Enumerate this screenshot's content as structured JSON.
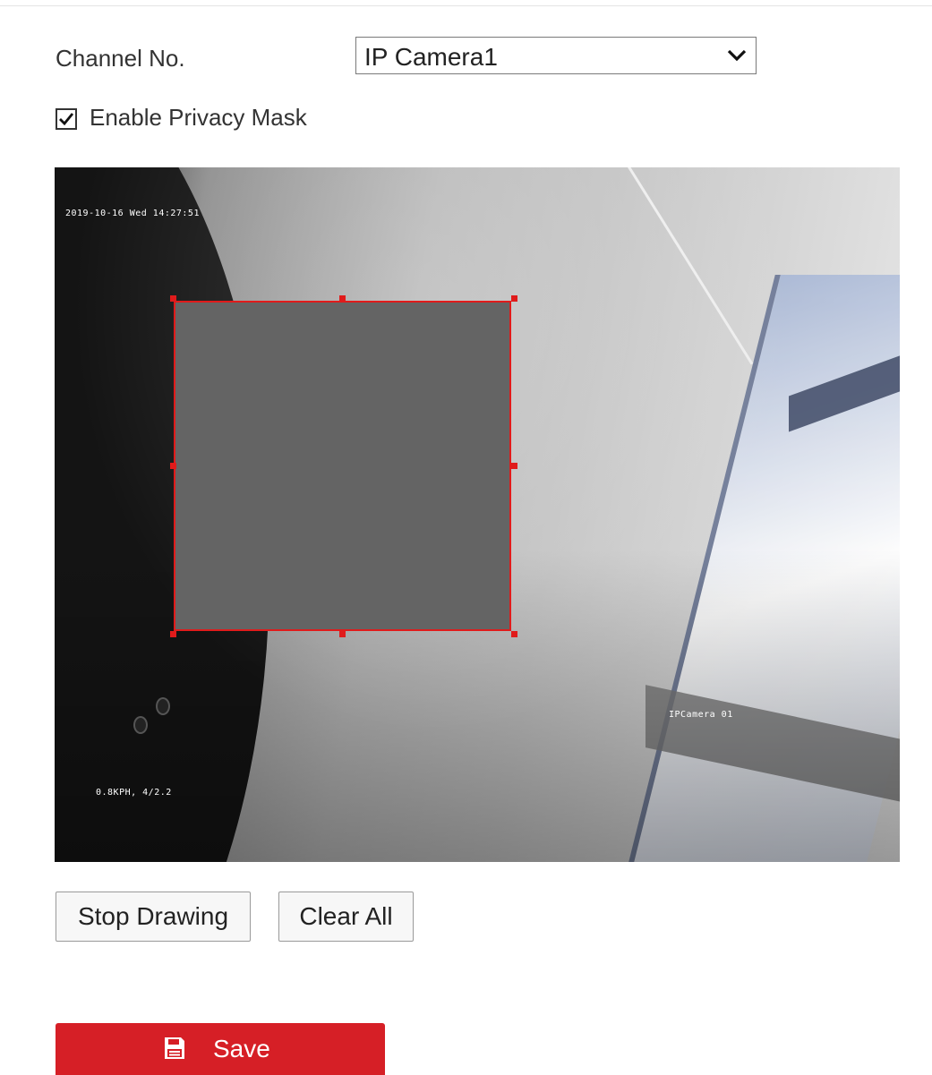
{
  "form": {
    "channel_label": "Channel No.",
    "channel_value": "IP Camera1",
    "privacy_mask_label": "Enable Privacy Mask",
    "privacy_mask_checked": true
  },
  "video": {
    "osd_timestamp": "2019-10-16 Wed 14:27:51",
    "osd_camera_name": "IPCamera 01",
    "osd_lens": "0.8KPH, 4/2.2"
  },
  "buttons": {
    "stop_drawing": "Stop Drawing",
    "clear_all": "Clear All",
    "save": "Save"
  },
  "colors": {
    "mask_outline": "#e01b1b",
    "mask_fill": "#646464",
    "save_background": "#d61f26"
  },
  "icons": {
    "select_arrow": "chevron-down-icon",
    "checkbox": "checkmark-icon",
    "save": "floppy-disk-icon"
  }
}
